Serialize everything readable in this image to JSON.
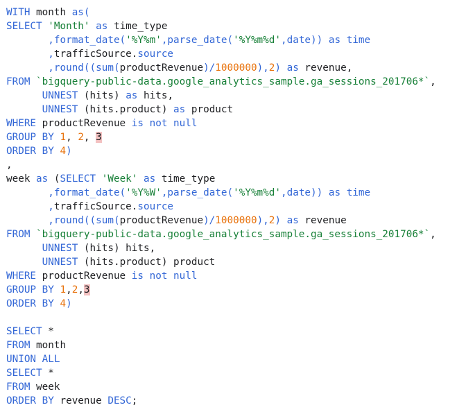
{
  "editor": {
    "lines": [
      [
        {
          "t": "kw",
          "v": "WITH"
        },
        {
          "t": "txt",
          "v": " month "
        },
        {
          "t": "kw",
          "v": "as("
        }
      ],
      [
        {
          "t": "kw",
          "v": "SELECT"
        },
        {
          "t": "txt",
          "v": " "
        },
        {
          "t": "str",
          "v": "'Month'"
        },
        {
          "t": "txt",
          "v": " "
        },
        {
          "t": "kw",
          "v": "as"
        },
        {
          "t": "txt",
          "v": " time_type"
        }
      ],
      [
        {
          "t": "txt",
          "v": "       "
        },
        {
          "t": "fn",
          "v": ",format_date("
        },
        {
          "t": "str",
          "v": "'%Y%m'"
        },
        {
          "t": "fn",
          "v": ",parse_date("
        },
        {
          "t": "str",
          "v": "'%Y%m%d'"
        },
        {
          "t": "fn",
          "v": ",date))"
        },
        {
          "t": "txt",
          "v": " "
        },
        {
          "t": "kw",
          "v": "as"
        },
        {
          "t": "txt",
          "v": " "
        },
        {
          "t": "kw",
          "v": "time"
        }
      ],
      [
        {
          "t": "txt",
          "v": "       "
        },
        {
          "t": "fn",
          "v": ","
        },
        {
          "t": "txt",
          "v": "trafficSource."
        },
        {
          "t": "kw",
          "v": "source"
        }
      ],
      [
        {
          "t": "txt",
          "v": "       "
        },
        {
          "t": "fn",
          "v": ",round((sum("
        },
        {
          "t": "txt",
          "v": "productRevenue"
        },
        {
          "t": "fn",
          "v": ")/"
        },
        {
          "t": "num",
          "v": "1000000"
        },
        {
          "t": "fn",
          "v": "),"
        },
        {
          "t": "num",
          "v": "2"
        },
        {
          "t": "fn",
          "v": ")"
        },
        {
          "t": "txt",
          "v": " "
        },
        {
          "t": "kw",
          "v": "as"
        },
        {
          "t": "txt",
          "v": " revenue,"
        }
      ],
      [
        {
          "t": "kw",
          "v": "FROM"
        },
        {
          "t": "txt",
          "v": " "
        },
        {
          "t": "str",
          "v": "`bigquery-public-data.google_analytics_sample.ga_sessions_201706*`"
        },
        {
          "t": "txt",
          "v": ","
        }
      ],
      [
        {
          "t": "txt",
          "v": "      "
        },
        {
          "t": "kw",
          "v": "UNNEST"
        },
        {
          "t": "txt",
          "v": " (hits) "
        },
        {
          "t": "kw",
          "v": "as"
        },
        {
          "t": "txt",
          "v": " hits,"
        }
      ],
      [
        {
          "t": "txt",
          "v": "      "
        },
        {
          "t": "kw",
          "v": "UNNEST"
        },
        {
          "t": "txt",
          "v": " (hits.product) "
        },
        {
          "t": "kw",
          "v": "as"
        },
        {
          "t": "txt",
          "v": " product"
        }
      ],
      [
        {
          "t": "kw",
          "v": "WHERE"
        },
        {
          "t": "txt",
          "v": " productRevenue "
        },
        {
          "t": "kw",
          "v": "is not null"
        }
      ],
      [
        {
          "t": "kw",
          "v": "GROUP BY"
        },
        {
          "t": "txt",
          "v": " "
        },
        {
          "t": "num",
          "v": "1"
        },
        {
          "t": "txt",
          "v": ", "
        },
        {
          "t": "num",
          "v": "2"
        },
        {
          "t": "txt",
          "v": ", "
        },
        {
          "t": "hl",
          "v": "3"
        }
      ],
      [
        {
          "t": "kw",
          "v": "ORDER BY"
        },
        {
          "t": "txt",
          "v": " "
        },
        {
          "t": "num",
          "v": "4"
        },
        {
          "t": "fn",
          "v": ")"
        }
      ],
      [
        {
          "t": "txt",
          "v": ","
        }
      ],
      [
        {
          "t": "txt",
          "v": "week "
        },
        {
          "t": "kw",
          "v": "as"
        },
        {
          "t": "txt",
          "v": " ("
        },
        {
          "t": "kw",
          "v": "SELECT"
        },
        {
          "t": "txt",
          "v": " "
        },
        {
          "t": "str",
          "v": "'Week'"
        },
        {
          "t": "txt",
          "v": " "
        },
        {
          "t": "kw",
          "v": "as"
        },
        {
          "t": "txt",
          "v": " time_type"
        }
      ],
      [
        {
          "t": "txt",
          "v": "       "
        },
        {
          "t": "fn",
          "v": ",format_date("
        },
        {
          "t": "str",
          "v": "'%Y%W'"
        },
        {
          "t": "fn",
          "v": ",parse_date("
        },
        {
          "t": "str",
          "v": "'%Y%m%d'"
        },
        {
          "t": "fn",
          "v": ",date))"
        },
        {
          "t": "txt",
          "v": " "
        },
        {
          "t": "kw",
          "v": "as"
        },
        {
          "t": "txt",
          "v": " "
        },
        {
          "t": "kw",
          "v": "time"
        }
      ],
      [
        {
          "t": "txt",
          "v": "       "
        },
        {
          "t": "fn",
          "v": ","
        },
        {
          "t": "txt",
          "v": "trafficSource."
        },
        {
          "t": "kw",
          "v": "source"
        }
      ],
      [
        {
          "t": "txt",
          "v": "       "
        },
        {
          "t": "fn",
          "v": ",round((sum("
        },
        {
          "t": "txt",
          "v": "productRevenue"
        },
        {
          "t": "fn",
          "v": ")/"
        },
        {
          "t": "num",
          "v": "1000000"
        },
        {
          "t": "fn",
          "v": "),"
        },
        {
          "t": "num",
          "v": "2"
        },
        {
          "t": "fn",
          "v": ")"
        },
        {
          "t": "txt",
          "v": " "
        },
        {
          "t": "kw",
          "v": "as"
        },
        {
          "t": "txt",
          "v": " revenue"
        }
      ],
      [
        {
          "t": "kw",
          "v": "FROM"
        },
        {
          "t": "txt",
          "v": " "
        },
        {
          "t": "str",
          "v": "`bigquery-public-data.google_analytics_sample.ga_sessions_201706*`"
        },
        {
          "t": "txt",
          "v": ","
        }
      ],
      [
        {
          "t": "txt",
          "v": "      "
        },
        {
          "t": "kw",
          "v": "UNNEST"
        },
        {
          "t": "txt",
          "v": " (hits) hits,"
        }
      ],
      [
        {
          "t": "txt",
          "v": "      "
        },
        {
          "t": "kw",
          "v": "UNNEST"
        },
        {
          "t": "txt",
          "v": " (hits.product) product"
        }
      ],
      [
        {
          "t": "kw",
          "v": "WHERE"
        },
        {
          "t": "txt",
          "v": " productRevenue "
        },
        {
          "t": "kw",
          "v": "is not null"
        }
      ],
      [
        {
          "t": "kw",
          "v": "GROUP BY"
        },
        {
          "t": "txt",
          "v": " "
        },
        {
          "t": "num",
          "v": "1"
        },
        {
          "t": "txt",
          "v": ","
        },
        {
          "t": "num",
          "v": "2"
        },
        {
          "t": "txt",
          "v": ","
        },
        {
          "t": "hl",
          "v": "3"
        }
      ],
      [
        {
          "t": "kw",
          "v": "ORDER BY"
        },
        {
          "t": "txt",
          "v": " "
        },
        {
          "t": "num",
          "v": "4"
        },
        {
          "t": "fn",
          "v": ")"
        }
      ],
      [],
      [
        {
          "t": "kw",
          "v": "SELECT"
        },
        {
          "t": "txt",
          "v": " *"
        }
      ],
      [
        {
          "t": "kw",
          "v": "FROM"
        },
        {
          "t": "txt",
          "v": " month"
        }
      ],
      [
        {
          "t": "kw",
          "v": "UNION ALL"
        }
      ],
      [
        {
          "t": "kw",
          "v": "SELECT"
        },
        {
          "t": "txt",
          "v": " *"
        }
      ],
      [
        {
          "t": "kw",
          "v": "FROM"
        },
        {
          "t": "txt",
          "v": " week"
        }
      ],
      [
        {
          "t": "kw",
          "v": "ORDER BY"
        },
        {
          "t": "txt",
          "v": " revenue "
        },
        {
          "t": "kw",
          "v": "DESC"
        },
        {
          "t": "txt",
          "v": ";"
        }
      ]
    ]
  },
  "colors": {
    "keyword": "#3367d6",
    "string": "#188038",
    "number": "#e8710a",
    "highlight": "#f3c1c1",
    "text": "#202124",
    "background": "#ffffff"
  }
}
